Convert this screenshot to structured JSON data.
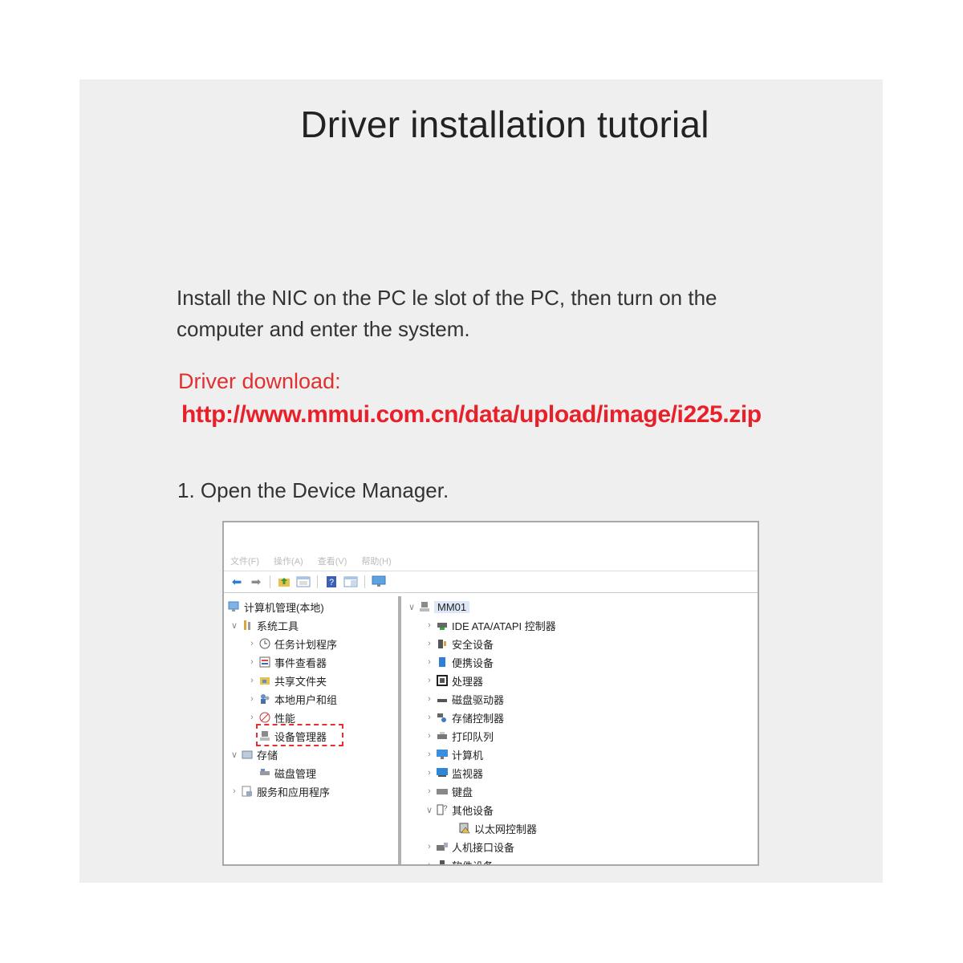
{
  "title": "Driver installation tutorial",
  "intro": "Install the NIC on the PC le slot of the PC, then turn on the computer and enter the system.",
  "driver_download_label": "Driver download:",
  "driver_download_url": "http://www.mmui.com.cn/data/upload/image/i225.zip",
  "step1": "1. Open the Device Manager.",
  "window": {
    "menu": [
      "文件(F)",
      "操作(A)",
      "查看(V)",
      "帮助(H)"
    ],
    "toolbar_icons": [
      "back-arrow-icon",
      "forward-arrow-icon",
      "folder-up-icon",
      "properties-icon",
      "help-icon",
      "view-icon",
      "monitor-icon"
    ],
    "left_tree": [
      {
        "label": "计算机管理(本地)",
        "icon": "computer-management-icon",
        "chevron": ""
      },
      {
        "label": "系统工具",
        "icon": "system-tools-icon",
        "chevron": "down"
      },
      {
        "label": "任务计划程序",
        "icon": "clock-icon",
        "chevron": "right"
      },
      {
        "label": "事件查看器",
        "icon": "event-viewer-icon",
        "chevron": "right"
      },
      {
        "label": "共享文件夹",
        "icon": "shared-folder-icon",
        "chevron": "right"
      },
      {
        "label": "本地用户和组",
        "icon": "users-icon",
        "chevron": "right"
      },
      {
        "label": "性能",
        "icon": "performance-icon",
        "chevron": "right"
      },
      {
        "label": "设备管理器",
        "icon": "device-manager-icon",
        "chevron": ""
      },
      {
        "label": "存储",
        "icon": "storage-icon",
        "chevron": "down"
      },
      {
        "label": "磁盘管理",
        "icon": "disk-management-icon",
        "chevron": ""
      },
      {
        "label": "服务和应用程序",
        "icon": "services-icon",
        "chevron": "right"
      }
    ],
    "right_tree": [
      {
        "label": "MM01",
        "icon": "computer-icon",
        "chevron": "down"
      },
      {
        "label": "IDE ATA/ATAPI 控制器",
        "icon": "ide-controller-icon",
        "chevron": "right"
      },
      {
        "label": "安全设备",
        "icon": "security-device-icon",
        "chevron": "right"
      },
      {
        "label": "便携设备",
        "icon": "portable-device-icon",
        "chevron": "right"
      },
      {
        "label": "处理器",
        "icon": "processor-icon",
        "chevron": "right"
      },
      {
        "label": "磁盘驱动器",
        "icon": "disk-drive-icon",
        "chevron": "right"
      },
      {
        "label": "存储控制器",
        "icon": "storage-controller-icon",
        "chevron": "right"
      },
      {
        "label": "打印队列",
        "icon": "printer-icon",
        "chevron": "right"
      },
      {
        "label": "计算机",
        "icon": "computer-icon",
        "chevron": "right"
      },
      {
        "label": "监视器",
        "icon": "monitor-icon",
        "chevron": "right"
      },
      {
        "label": "键盘",
        "icon": "keyboard-icon",
        "chevron": "right"
      },
      {
        "label": "其他设备",
        "icon": "other-devices-icon",
        "chevron": "down"
      },
      {
        "label": "以太网控制器",
        "icon": "ethernet-controller-warning-icon",
        "chevron": ""
      },
      {
        "label": "人机接口设备",
        "icon": "hid-icon",
        "chevron": "right"
      },
      {
        "label": "软件设备",
        "icon": "software-device-icon",
        "chevron": "right"
      }
    ]
  },
  "colors": {
    "accent_red": "#e8202a",
    "panel_bg": "#efefef",
    "highlight_border": "#e53030"
  }
}
